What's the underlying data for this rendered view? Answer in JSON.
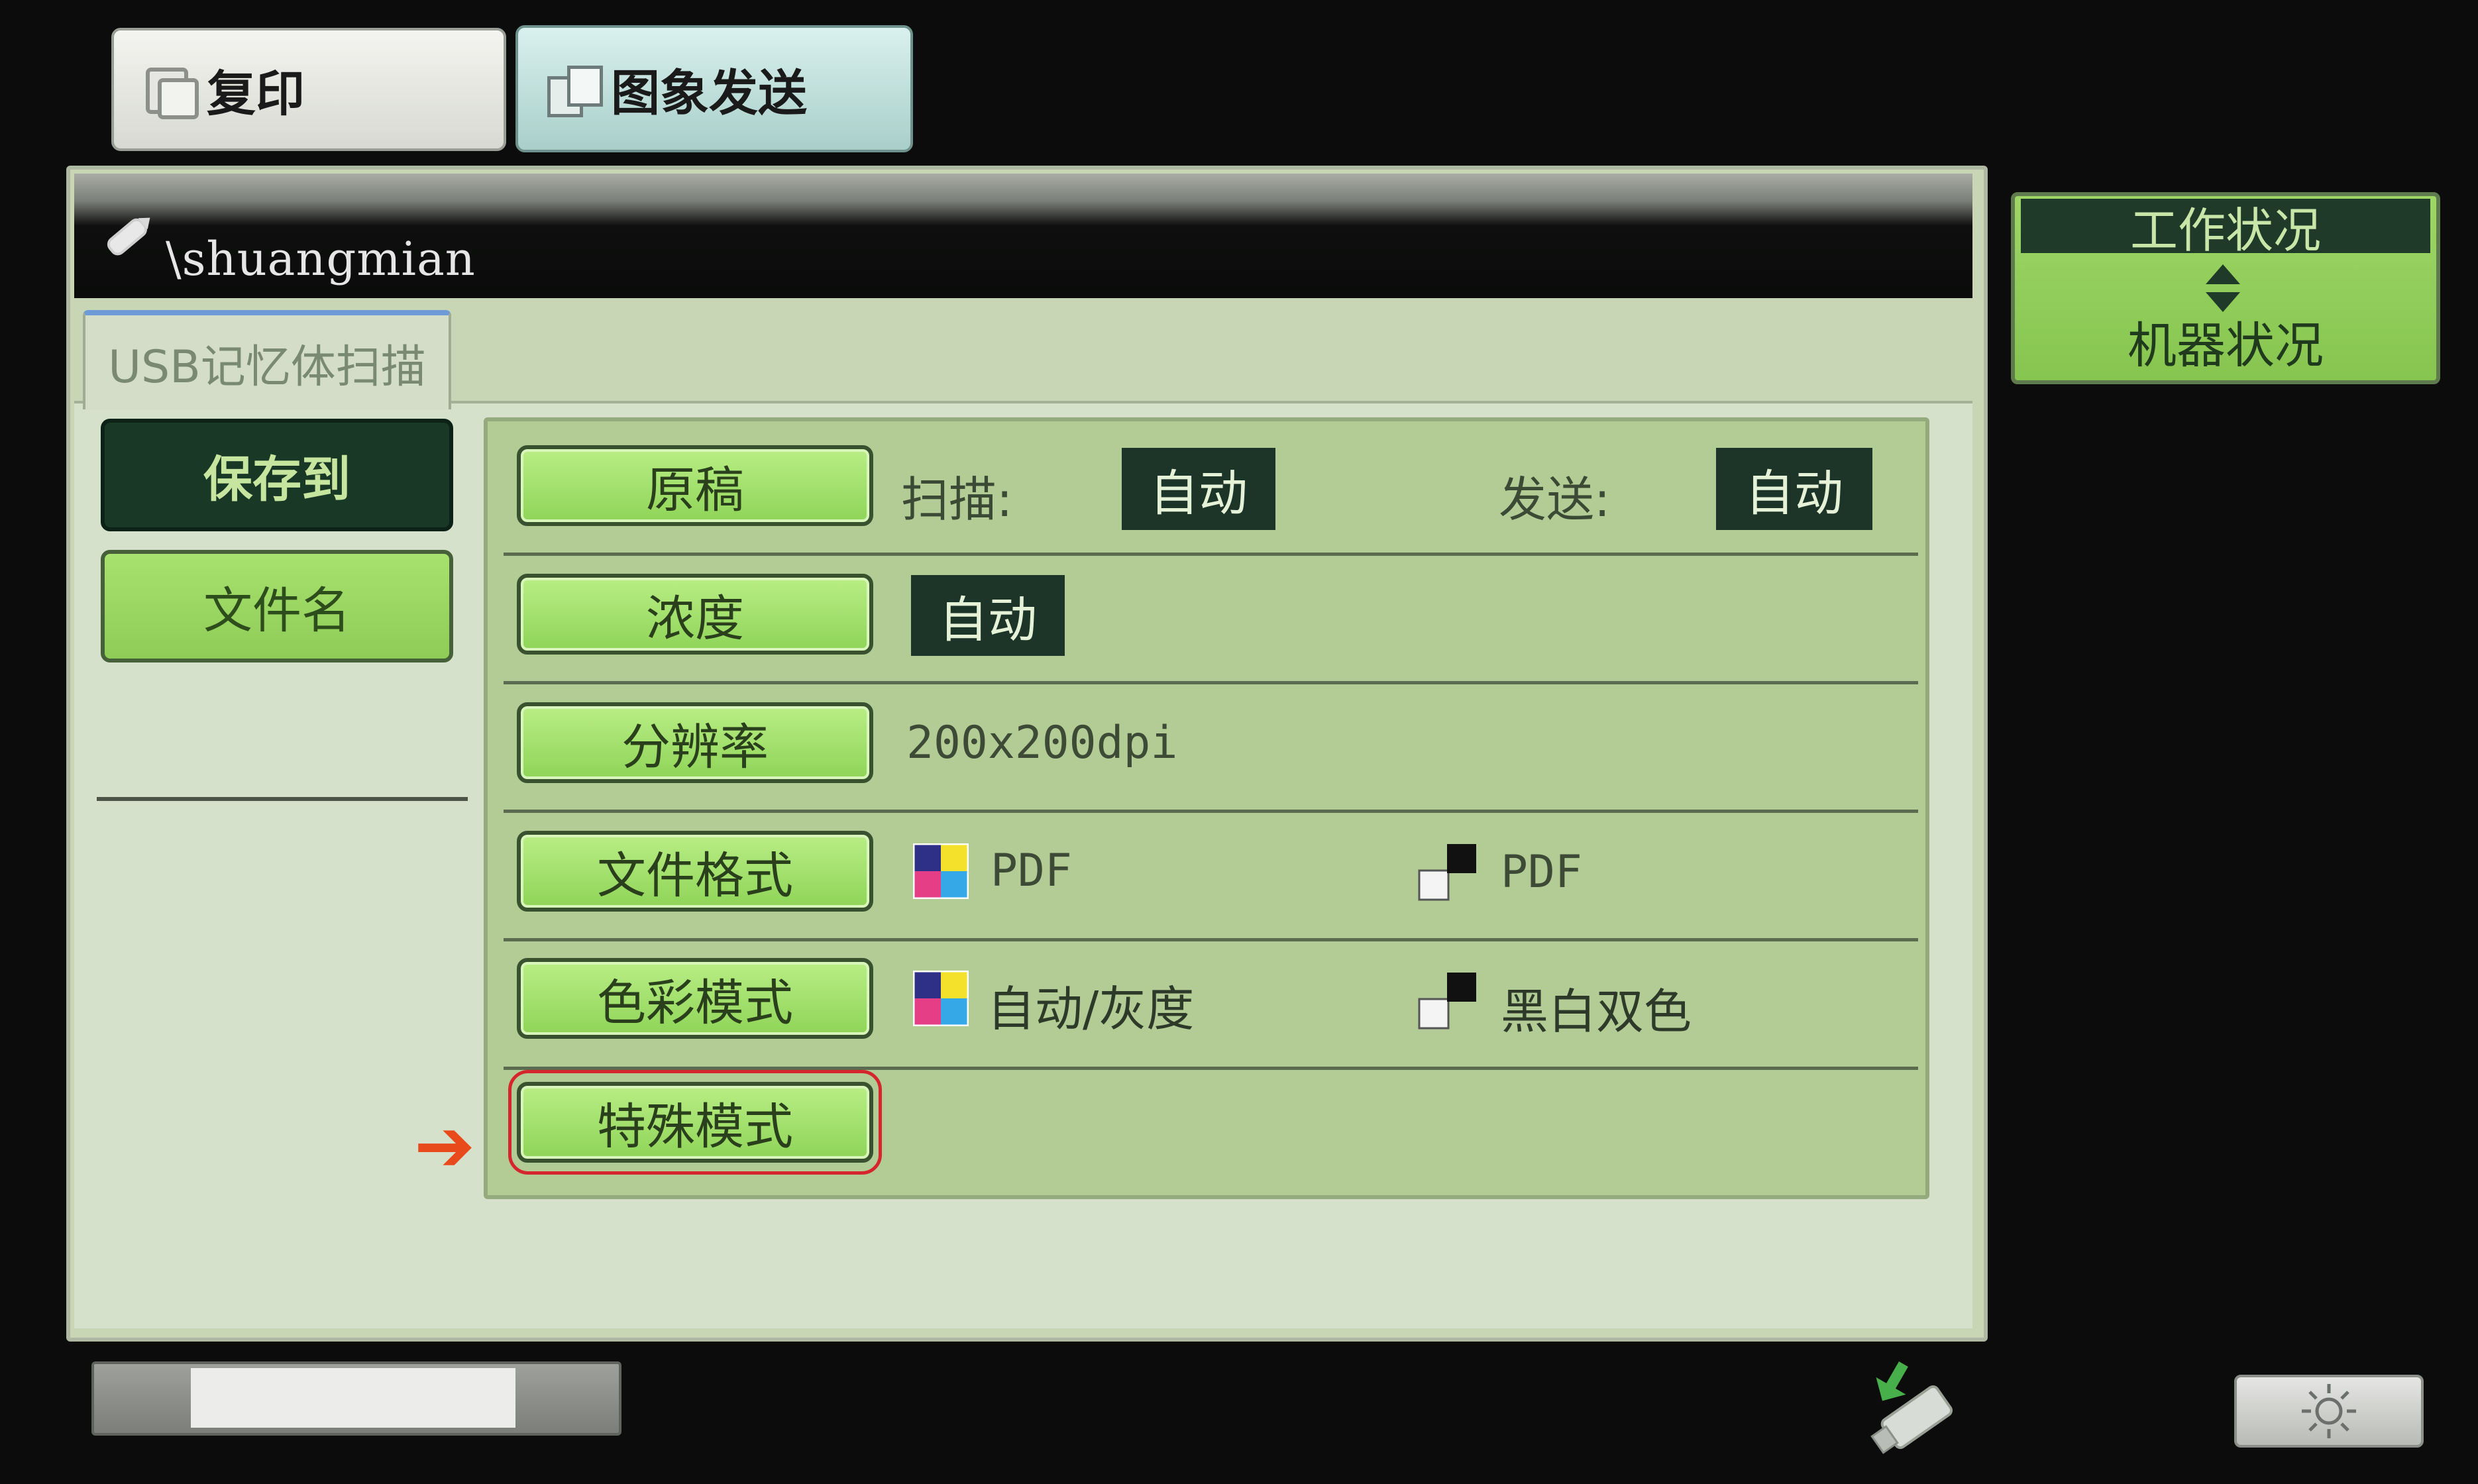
{
  "top_tabs": {
    "copy": "复印",
    "image_send": "图象发送"
  },
  "header": {
    "path": "\\shuangmian"
  },
  "mode_tab": "USB记忆体扫描",
  "left_nav": {
    "save_to": "保存到",
    "file_name": "文件名"
  },
  "settings": {
    "original": {
      "button": "原稿",
      "scan_label": "扫描:",
      "scan_value": "自动",
      "send_label": "发送:",
      "send_value": "自动"
    },
    "density": {
      "button": "浓度",
      "value": "自动"
    },
    "resolution": {
      "button": "分辨率",
      "value": "200x200dpi"
    },
    "file_format": {
      "button": "文件格式",
      "color_value": "PDF",
      "mono_value": "PDF"
    },
    "color_mode": {
      "button": "色彩模式",
      "color_value": "自动/灰度",
      "mono_value": "黑白双色"
    },
    "special_mode": {
      "button": "特殊模式"
    }
  },
  "annotation": {
    "arrow": "➔",
    "color": "#e84a1c",
    "ring_color": "#d4262c"
  },
  "status_button": {
    "top": "工作状况",
    "bottom": "机器状况"
  },
  "icons": {
    "copy": "copy-icon",
    "send": "image-send-icon",
    "pencil": "pencil-icon",
    "color": "color-swatch-icon",
    "mono": "mono-swatch-icon",
    "updown": "up-down-arrow-icon",
    "usb": "usb-memory-icon",
    "brightness": "brightness-icon"
  },
  "colors": {
    "accent_green": "#8fd458",
    "dark_green": "#1d3428",
    "panel_bg": "#b3cc95"
  }
}
